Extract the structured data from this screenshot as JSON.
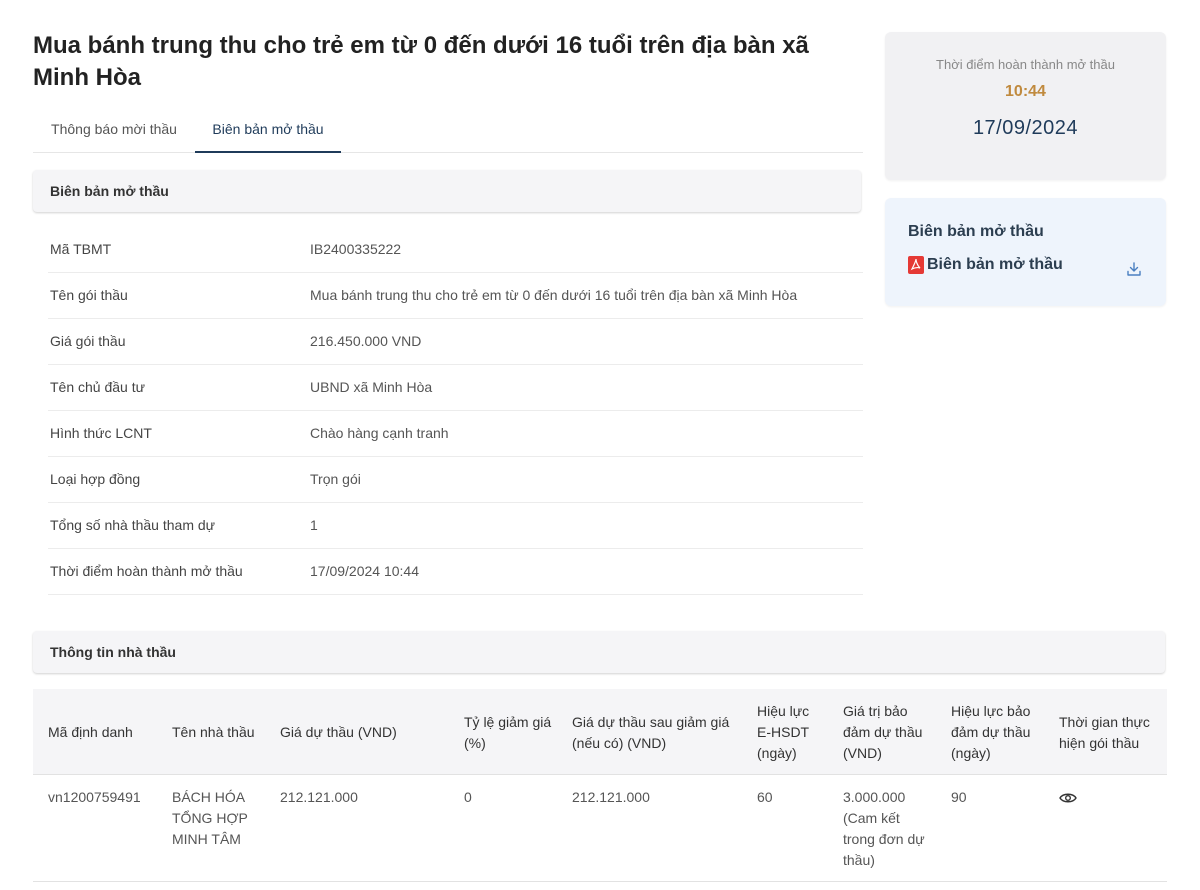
{
  "page": {
    "title": "Mua bánh trung thu cho trẻ em từ 0 đến dưới 16 tuổi trên địa bàn xã Minh Hòa"
  },
  "tabs": [
    {
      "label": "Thông báo mời thầu",
      "active": false
    },
    {
      "label": "Biên bản mở thầu",
      "active": true
    }
  ],
  "section1": {
    "title": "Biên bản mở thầu",
    "rows": [
      {
        "label": "Mã TBMT",
        "value": "IB2400335222"
      },
      {
        "label": "Tên gói thầu",
        "value": "Mua bánh trung thu cho trẻ em từ 0 đến dưới 16 tuổi trên địa bàn xã Minh Hòa"
      },
      {
        "label": "Giá gói thầu",
        "value": "216.450.000 VND"
      },
      {
        "label": "Tên chủ đầu tư",
        "value": "UBND xã Minh Hòa"
      },
      {
        "label": "Hình thức LCNT",
        "value": "Chào hàng cạnh tranh"
      },
      {
        "label": "Loại hợp đồng",
        "value": "Trọn gói"
      },
      {
        "label": "Tổng số nhà thầu tham dự",
        "value": "1"
      },
      {
        "label": "Thời điểm hoàn thành mở thầu",
        "value": "17/09/2024 10:44"
      }
    ]
  },
  "time_card": {
    "label": "Thời điểm hoàn thành mở thầu",
    "hour": "10:44",
    "date": "17/09/2024"
  },
  "doc_card": {
    "title": "Biên bản mở thầu",
    "file_label": "Biên bản mở thầu",
    "file_icon": "pdf-icon",
    "action_icon": "download-icon"
  },
  "section2": {
    "title": "Thông tin nhà thầu",
    "columns": [
      "Mã định danh",
      "Tên nhà thầu",
      "Giá dự thầu (VND)",
      "Tỷ lệ giảm giá (%)",
      "Giá dự thầu sau giảm giá (nếu có) (VND)",
      "Hiệu lực E-HSDT (ngày)",
      "Giá trị bảo đảm dự thầu (VND)",
      "Hiệu lực bảo đảm dự thầu (ngày)",
      "Thời gian thực hiện gói thầu"
    ],
    "rows": [
      {
        "id": "vn1200759491",
        "name": "BÁCH HÓA TỔNG HỢP MINH TÂM",
        "bid_price": "212.121.000",
        "discount": "0",
        "price_after": "212.121.000",
        "validity": "60",
        "guarantee": "3.000.000 (Cam kết trong đơn dự thầu)",
        "guarantee_validity": "90",
        "duration_icon": "eye-icon"
      }
    ]
  },
  "colors": {
    "accent": "#1f3b5a",
    "time_highlight": "#c08a3e",
    "doc_card_bg": "#eef4fc",
    "pdf_red": "#e53935"
  }
}
